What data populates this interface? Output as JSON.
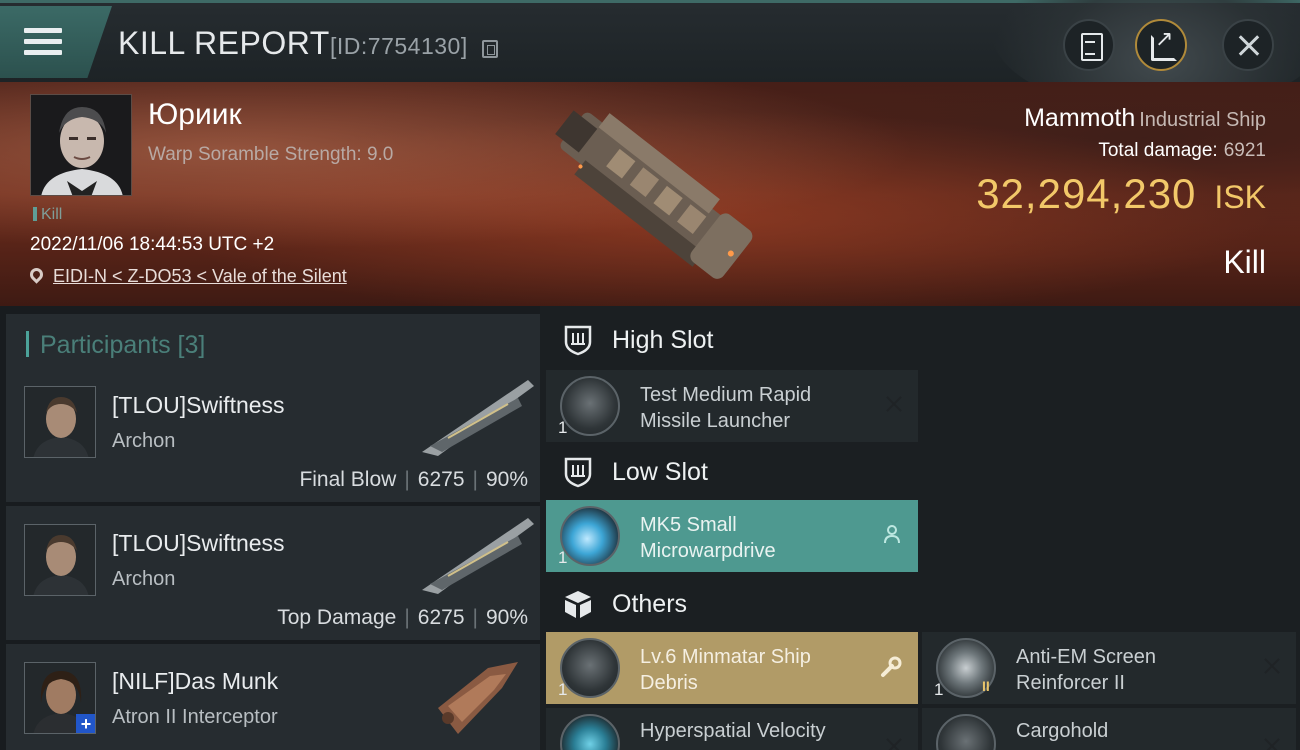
{
  "header": {
    "title": "KILL REPORT",
    "id_text": "[ID:7754130]"
  },
  "victim": {
    "name": "Юриик",
    "scramble": "Warp Soramble Strength: 9.0",
    "tag": "Kill",
    "datetime": "2022/11/06 18:44:53 UTC +2",
    "location": "EIDI-N < Z-DO53 < Vale of the Silent"
  },
  "ship": {
    "name": "Mammoth",
    "class": "Industrial Ship",
    "total_damage_label": "Total damage:",
    "total_damage": "6921",
    "isk_value": "32,294,230",
    "isk_unit": "ISK",
    "result": "Kill"
  },
  "participants": {
    "title": "Participants [3]",
    "items": [
      {
        "name": "[TLOU]Swiftness",
        "ship": "Archon",
        "role": "Final Blow",
        "damage": "6275",
        "percent": "90%"
      },
      {
        "name": "[TLOU]Swiftness",
        "ship": "Archon",
        "role": "Top Damage",
        "damage": "6275",
        "percent": "90%"
      },
      {
        "name": "[NILF]Das Munk",
        "ship": "Atron II Interceptor"
      }
    ]
  },
  "slots": {
    "high": {
      "label": "High Slot",
      "items": [
        {
          "name_line1": "Test Medium Rapid",
          "name_line2": "Missile Launcher",
          "qty": "1"
        }
      ]
    },
    "low": {
      "label": "Low Slot",
      "items": [
        {
          "name_line1": "MK5 Small",
          "name_line2": "Microwarpdrive",
          "qty": "1"
        }
      ]
    },
    "others": {
      "label": "Others",
      "items": [
        {
          "name_line1": "Lv.6 Minmatar Ship",
          "name_line2": "Debris",
          "qty": "1"
        },
        {
          "name_line1": "Anti-EM Screen",
          "name_line2": "Reinforcer II",
          "qty": "1",
          "rank": "II"
        },
        {
          "name_line1": "Hyperspatial Velocity",
          "name_line2": ""
        },
        {
          "name_line1": "Cargohold",
          "name_line2": ""
        }
      ]
    }
  },
  "colors": {
    "accent_teal": "#4e9990",
    "accent_gold": "#b19b67",
    "isk_gold": "#f2c869"
  },
  "icons": {
    "menu": "hamburger-icon",
    "copy": "copy-icon",
    "clipboard": "clipboard-icon",
    "share": "share-icon",
    "close": "close-icon",
    "location": "pin-icon",
    "high_slot": "shield-slot-icon",
    "low_slot": "shield-slot-icon",
    "others": "cube-icon",
    "pilot_badge": "person-icon",
    "wrench_badge": "wrench-icon"
  }
}
